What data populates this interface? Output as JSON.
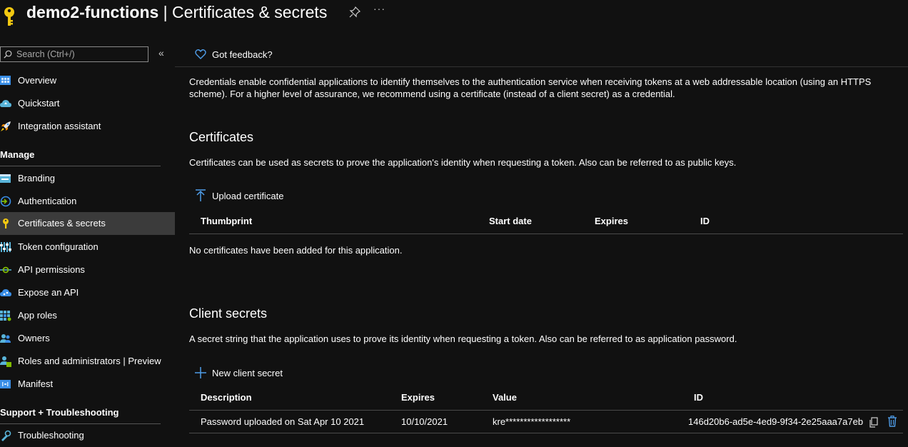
{
  "header": {
    "app_name": "demo2-functions",
    "page_name": " | Certificates & secrets",
    "more_label": "···"
  },
  "sidebar": {
    "search_placeholder": "Search (Ctrl+/)",
    "collapse_label": "«",
    "top_items": [
      {
        "label": "Overview",
        "icon": "overview-icon"
      },
      {
        "label": "Quickstart",
        "icon": "quickstart-icon"
      },
      {
        "label": "Integration assistant",
        "icon": "rocket-icon"
      }
    ],
    "manage_heading": "Manage",
    "manage_items": [
      {
        "label": "Branding",
        "icon": "branding-icon"
      },
      {
        "label": "Authentication",
        "icon": "authentication-icon"
      },
      {
        "label": "Certificates & secrets",
        "icon": "key-icon",
        "active": true
      },
      {
        "label": "Token configuration",
        "icon": "token-config-icon"
      },
      {
        "label": "API permissions",
        "icon": "api-permissions-icon"
      },
      {
        "label": "Expose an API",
        "icon": "cloud-icon"
      },
      {
        "label": "App roles",
        "icon": "app-roles-icon"
      },
      {
        "label": "Owners",
        "icon": "owners-icon"
      },
      {
        "label": "Roles and administrators | Preview",
        "icon": "roles-admins-icon"
      },
      {
        "label": "Manifest",
        "icon": "manifest-icon"
      }
    ],
    "support_heading": "Support + Troubleshooting",
    "support_items": [
      {
        "label": "Troubleshooting",
        "icon": "troubleshooting-icon"
      }
    ]
  },
  "main": {
    "feedback_label": "Got feedback?",
    "intro": "Credentials enable confidential applications to identify themselves to the authentication service when receiving tokens at a web addressable location (using an HTTPS scheme). For a higher level of assurance, we recommend using a certificate (instead of a client secret) as a credential.",
    "certificates": {
      "heading": "Certificates",
      "description": "Certificates can be used as secrets to prove the application's identity when requesting a token. Also can be referred to as public keys.",
      "upload_label": "Upload certificate",
      "columns": [
        "Thumbprint",
        "Start date",
        "Expires",
        "ID"
      ],
      "empty_text": "No certificates have been added for this application."
    },
    "client_secrets": {
      "heading": "Client secrets",
      "description": "A secret string that the application uses to prove its identity when requesting a token. Also can be referred to as application password.",
      "new_label": "New client secret",
      "columns": [
        "Description",
        "Expires",
        "Value",
        "ID"
      ],
      "rows": [
        {
          "description": "Password uploaded on Sat Apr 10 2021",
          "expires": "10/10/2021",
          "value": "kre******************",
          "id": "146d20b6-ad5e-4ed9-9f34-2e25aaa7a7eb"
        }
      ]
    }
  },
  "colors": {
    "background": "#111111",
    "accent": "#4f9de8",
    "key": "#f2c811",
    "active_item": "#3b3b3b"
  }
}
